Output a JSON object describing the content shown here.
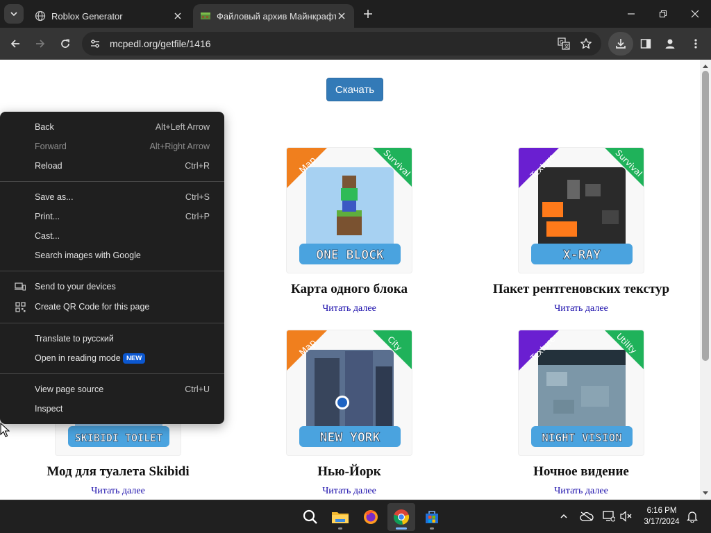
{
  "browser": {
    "tabs": [
      {
        "title": "Roblox Generator",
        "active": false,
        "favicon": "globe-icon"
      },
      {
        "title": "Файловый архив Майнкрафта",
        "active": true,
        "favicon": "minecraft-icon"
      }
    ],
    "url": "mcpedl.org/getfile/1416"
  },
  "page": {
    "download_button": "Скачать",
    "cards": [
      {
        "title": "Карта одного блока",
        "link": "Читать далее",
        "tag_left": "Map",
        "tag_right": "Survival",
        "banner": "ONE BLOCK",
        "tag_left_color": "#f07f1e",
        "tag_right_color": "#1fb25a"
      },
      {
        "title": "Пакет рентгеновских текстур",
        "link": "Читать далее",
        "tag_left": "Texture",
        "tag_right": "Survival",
        "banner": "X-RAY",
        "tag_left_color": "#6a1fd1",
        "tag_right_color": "#1fb25a"
      },
      {
        "title": "Мод для туалета Skibidi",
        "link": "Читать далее",
        "banner": "SKIBIDI TOILET"
      },
      {
        "title": "Нью-Йорк",
        "link": "Читать далее",
        "tag_left": "Map",
        "tag_right": "City",
        "banner": "NEW YORK",
        "tag_left_color": "#f07f1e",
        "tag_right_color": "#1fb25a"
      },
      {
        "title": "Ночное видение",
        "link": "Читать далее",
        "tag_left": "Texture",
        "tag_right": "Utility",
        "banner": "NIGHT VISION",
        "tag_left_color": "#6a1fd1",
        "tag_right_color": "#1fb25a"
      }
    ]
  },
  "context_menu": {
    "back": {
      "label": "Back",
      "shortcut": "Alt+Left Arrow"
    },
    "forward": {
      "label": "Forward",
      "shortcut": "Alt+Right Arrow"
    },
    "reload": {
      "label": "Reload",
      "shortcut": "Ctrl+R"
    },
    "save_as": {
      "label": "Save as...",
      "shortcut": "Ctrl+S"
    },
    "print": {
      "label": "Print...",
      "shortcut": "Ctrl+P"
    },
    "cast": {
      "label": "Cast..."
    },
    "search_images": {
      "label": "Search images with Google"
    },
    "send_devices": {
      "label": "Send to your devices"
    },
    "qr_code": {
      "label": "Create QR Code for this page"
    },
    "translate": {
      "label": "Translate to русский"
    },
    "reading_mode": {
      "label": "Open in reading mode",
      "badge": "NEW"
    },
    "view_source": {
      "label": "View page source",
      "shortcut": "Ctrl+U"
    },
    "inspect": {
      "label": "Inspect"
    }
  },
  "taskbar": {
    "time": "6:16 PM",
    "date": "3/17/2024"
  },
  "colors": {
    "download_button": "#337ab7",
    "link": "#1a0dab",
    "menu_bg": "#1f1f1f",
    "badge": "#0b57d0"
  }
}
